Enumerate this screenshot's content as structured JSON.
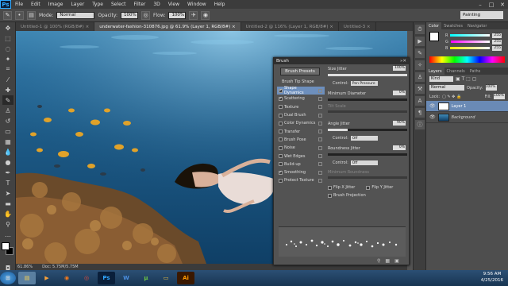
{
  "menubar": {
    "logo": "Ps",
    "items": [
      "File",
      "Edit",
      "Image",
      "Layer",
      "Type",
      "Select",
      "Filter",
      "3D",
      "View",
      "Window",
      "Help"
    ]
  },
  "options": {
    "mode_label": "Mode:",
    "mode_value": "Normal",
    "opacity_label": "Opacity:",
    "opacity_value": "100%",
    "flow_label": "Flow:",
    "flow_value": "100%",
    "workspace": "Painting"
  },
  "tabs": [
    "Untitled-1 @ 100% (RGB/8#) ×",
    "underwater-fashion-310876.jpg @ 61.9% (Layer 1, RGB/8#) ×",
    "Untitled-2 @ 116% (Layer 1, RGB/8#) ×",
    "Untitled-3 ×"
  ],
  "status": {
    "zoom": "61.86%",
    "doc": "Doc: 5.75M/5.75M"
  },
  "color_panel": {
    "tabs": [
      "Color",
      "Swatches",
      "Navigator"
    ],
    "r_label": "R",
    "r_value": "255",
    "g_label": "G",
    "g_value": "255",
    "b_label": "B",
    "b_value": "255"
  },
  "layers_panel": {
    "tabs": [
      "Layers",
      "Channels",
      "Paths"
    ],
    "kind_label": "Kind",
    "blend_value": "Normal",
    "opacity_label": "Opacity:",
    "opacity_value": "100%",
    "lock_label": "Lock:",
    "fill_label": "Fill:",
    "fill_value": "100%",
    "layers": [
      "Layer 1",
      "Background"
    ]
  },
  "brush_panel": {
    "title": "Brush",
    "presets_button": "Brush Presets",
    "tip_shape": "Brush Tip Shape",
    "items": [
      {
        "label": "Shape Dynamics",
        "checked": true
      },
      {
        "label": "Scattering",
        "checked": true
      },
      {
        "label": "Texture",
        "checked": false
      },
      {
        "label": "Dual Brush",
        "checked": false
      },
      {
        "label": "Color Dynamics",
        "checked": false
      },
      {
        "label": "Transfer",
        "checked": false
      },
      {
        "label": "Brush Pose",
        "checked": false
      },
      {
        "label": "Noise",
        "checked": false
      },
      {
        "label": "Wet Edges",
        "checked": false
      },
      {
        "label": "Build-up",
        "checked": false
      },
      {
        "label": "Smoothing",
        "checked": true
      },
      {
        "label": "Protect Texture",
        "checked": false
      }
    ],
    "size_jitter_label": "Size Jitter",
    "size_jitter_value": "100%",
    "control_label": "Control:",
    "control_size": "Pen Pressure",
    "min_diameter_label": "Minimum Diameter",
    "min_diameter_value": "0%",
    "tilt_scale_label": "Tilt Scale",
    "angle_jitter_label": "Angle Jitter",
    "angle_jitter_value": "90%",
    "control_angle": "Off",
    "roundness_jitter_label": "Roundness Jitter",
    "roundness_jitter_value": "0%",
    "control_roundness": "Off",
    "min_roundness_label": "Minimum Roundness",
    "flip_x": "Flip X Jitter",
    "flip_y": "Flip Y Jitter",
    "brush_projection": "Brush Projection"
  },
  "taskbar": {
    "apps": [
      "Start",
      "Explorer",
      "Media",
      "Firefox",
      "Chrome",
      "Photoshop",
      "Word",
      "uTorrent",
      "Folder",
      "Illustrator"
    ],
    "time": "9:56 AM",
    "date": "4/25/2016"
  }
}
